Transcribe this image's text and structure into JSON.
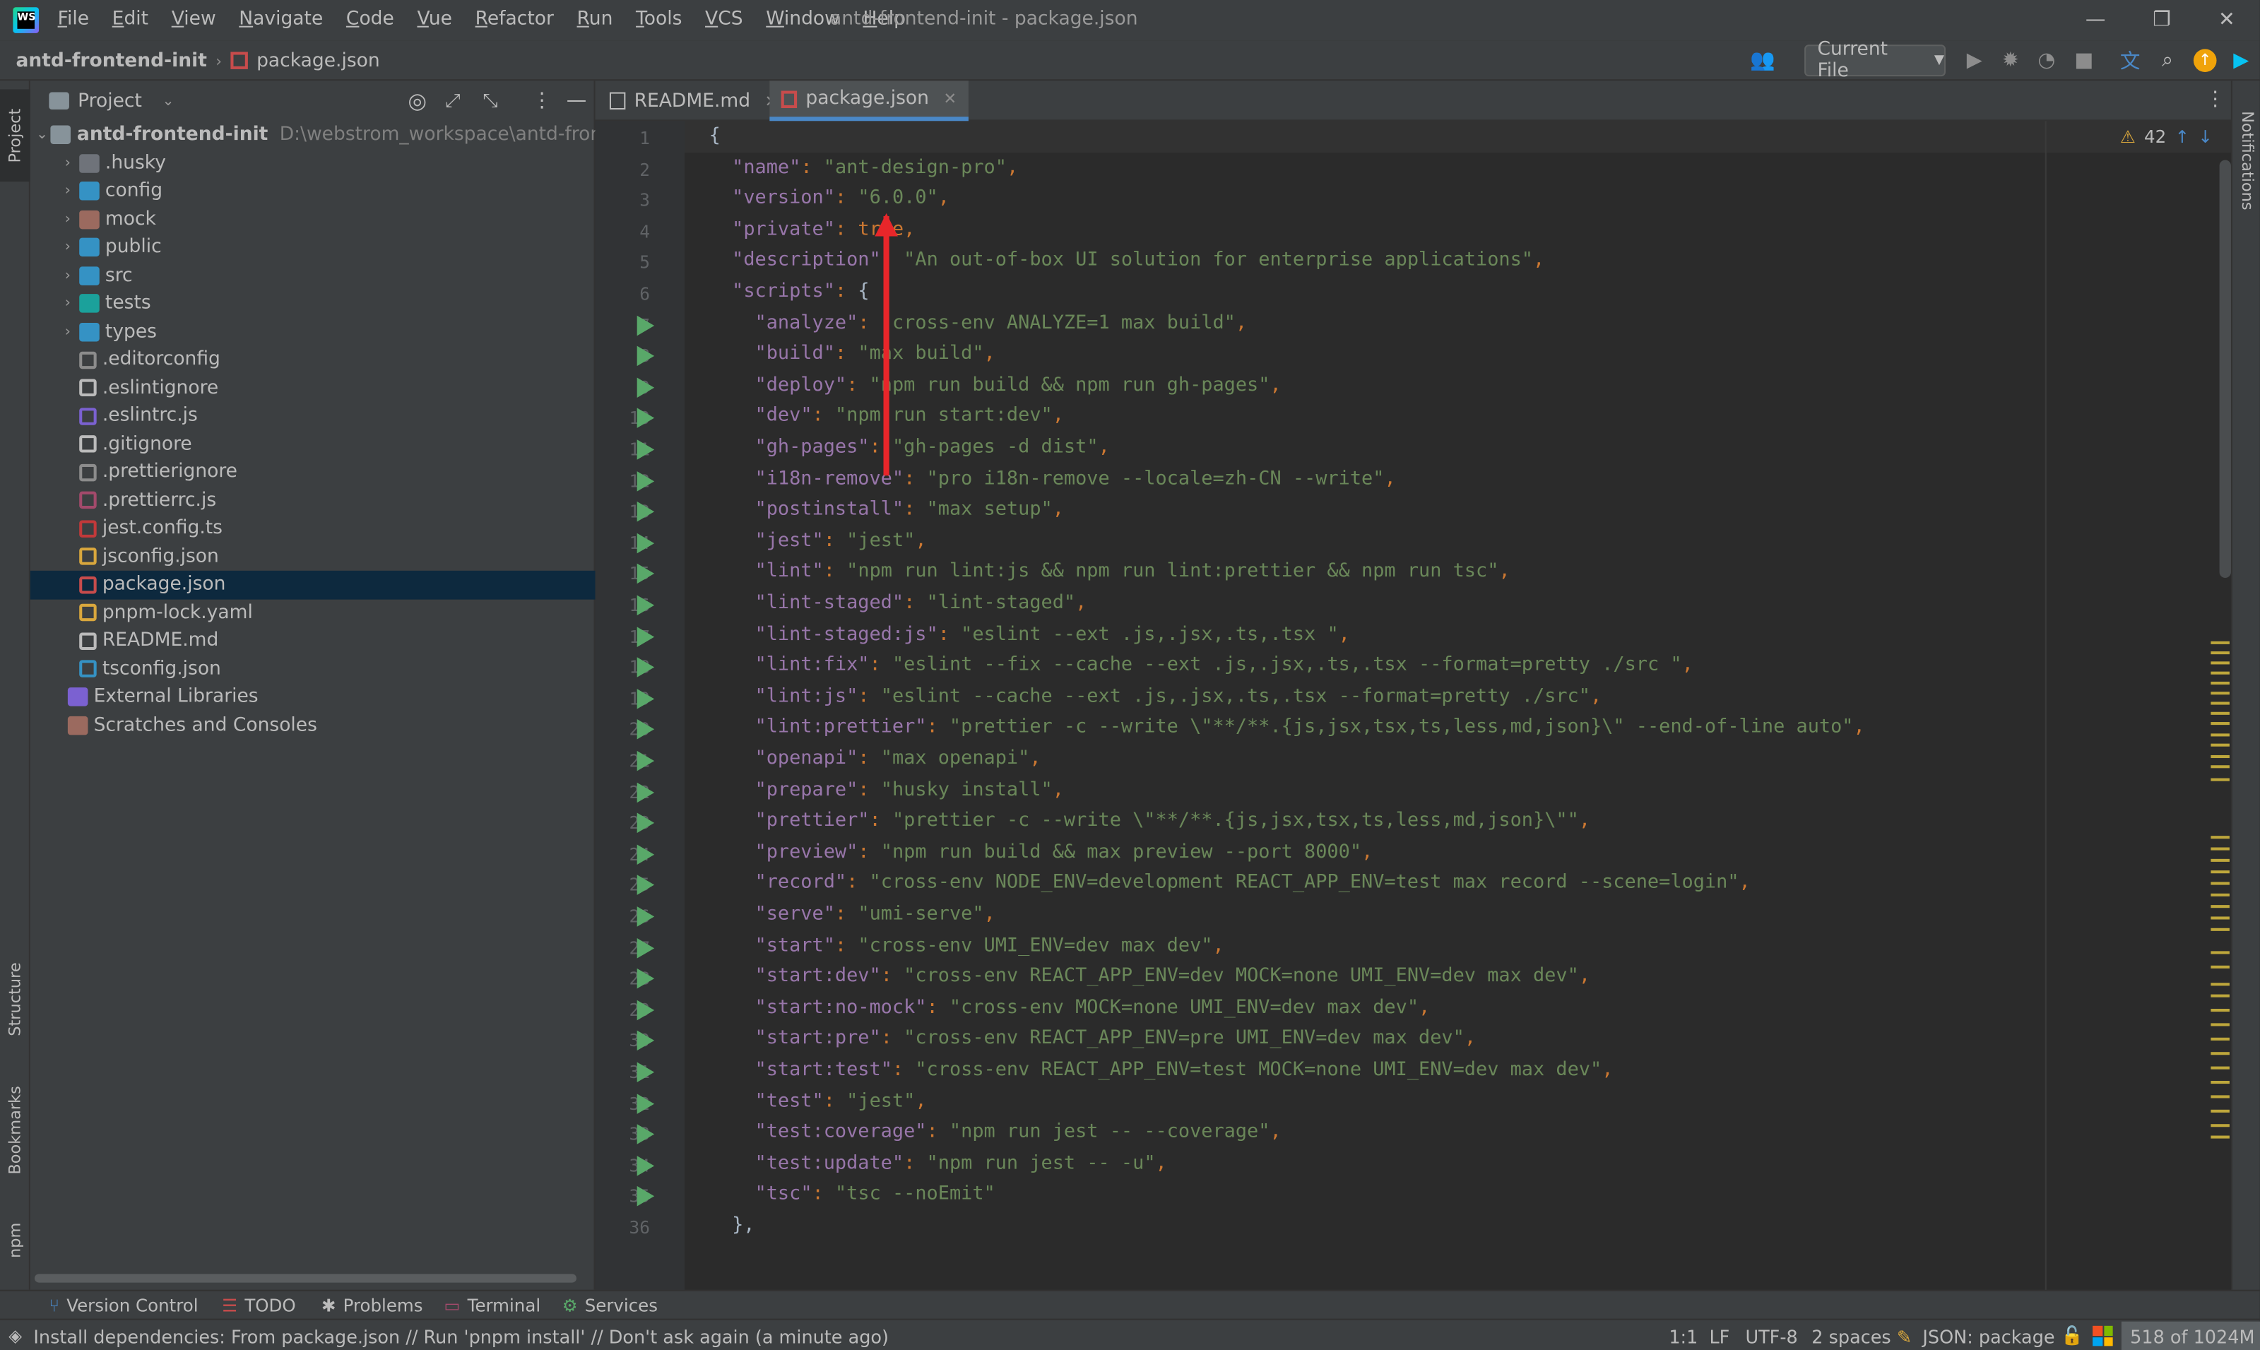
{
  "window": {
    "title": "antd-frontend-init - package.json",
    "menu": [
      "File",
      "Edit",
      "View",
      "Navigate",
      "Code",
      "Vue",
      "Refactor",
      "Run",
      "Tools",
      "VCS",
      "Window",
      "Help"
    ]
  },
  "navbar": {
    "project": "antd-frontend-init",
    "file": "package.json",
    "run_config": "Current File"
  },
  "project_panel": {
    "title": "Project",
    "root_name": "antd-frontend-init",
    "root_path": "D:\\webstrom_workspace\\antd-frontend-init",
    "items": [
      {
        "label": ".husky",
        "folder": true,
        "color": "#6f737a"
      },
      {
        "label": "config",
        "folder": true,
        "color": "#3592c4"
      },
      {
        "label": "mock",
        "folder": true,
        "color": "#9b6a5f"
      },
      {
        "label": "public",
        "folder": true,
        "color": "#3592c4"
      },
      {
        "label": "src",
        "folder": true,
        "color": "#3592c4"
      },
      {
        "label": "tests",
        "folder": true,
        "color": "#1ba19b"
      },
      {
        "label": "types",
        "folder": true,
        "color": "#3592c4"
      },
      {
        "label": ".editorconfig",
        "folder": false,
        "color": "#8c8c8c"
      },
      {
        "label": ".eslintignore",
        "folder": false,
        "color": "#bbbbbb"
      },
      {
        "label": ".eslintrc.js",
        "folder": false,
        "color": "#7b61d1"
      },
      {
        "label": ".gitignore",
        "folder": false,
        "color": "#bbbbbb"
      },
      {
        "label": ".prettierignore",
        "folder": false,
        "color": "#8c8c8c"
      },
      {
        "label": ".prettierrc.js",
        "folder": false,
        "color": "#a34a6b"
      },
      {
        "label": "jest.config.ts",
        "folder": false,
        "color": "#c2393a"
      },
      {
        "label": "jsconfig.json",
        "folder": false,
        "color": "#d9a73d"
      },
      {
        "label": "package.json",
        "folder": false,
        "color": "#c74c4c",
        "selected": true
      },
      {
        "label": "pnpm-lock.yaml",
        "folder": false,
        "color": "#d9a73d"
      },
      {
        "label": "README.md",
        "folder": false,
        "color": "#bbbbbb"
      },
      {
        "label": "tsconfig.json",
        "folder": false,
        "color": "#3592c4"
      }
    ],
    "extra": [
      "External Libraries",
      "Scratches and Consoles"
    ]
  },
  "tabs": [
    {
      "label": "README.md",
      "active": false
    },
    {
      "label": "package.json",
      "active": true
    }
  ],
  "inspection": {
    "warnings": "42"
  },
  "code_lines": [
    {
      "n": "1",
      "run": false,
      "text": "{"
    },
    {
      "n": "2",
      "run": false,
      "key": "name",
      "val": "ant-design-pro",
      "ind": 1
    },
    {
      "n": "3",
      "run": false,
      "key": "version",
      "val": "6.0.0",
      "ind": 1
    },
    {
      "n": "4",
      "run": false,
      "key": "private",
      "raw": "true",
      "ind": 1
    },
    {
      "n": "5",
      "run": false,
      "key": "description",
      "val": "An out-of-box UI solution for enterprise applications",
      "ind": 1
    },
    {
      "n": "6",
      "run": false,
      "key": "scripts",
      "raw": "{",
      "ind": 1,
      "nocomma": true
    },
    {
      "n": "7",
      "run": true,
      "key": "analyze",
      "val": "cross-env ANALYZE=1 max build",
      "ind": 2
    },
    {
      "n": "8",
      "run": true,
      "key": "build",
      "val": "max build",
      "ind": 2
    },
    {
      "n": "9",
      "run": true,
      "key": "deploy",
      "val": "npm run build && npm run gh-pages",
      "ind": 2
    },
    {
      "n": "10",
      "run": true,
      "key": "dev",
      "val": "npm run start:dev",
      "ind": 2
    },
    {
      "n": "11",
      "run": true,
      "key": "gh-pages",
      "val": "gh-pages -d dist",
      "ind": 2
    },
    {
      "n": "12",
      "run": true,
      "key": "i18n-remove",
      "val": "pro i18n-remove --locale=zh-CN --write",
      "ind": 2
    },
    {
      "n": "13",
      "run": true,
      "key": "postinstall",
      "val": "max setup",
      "ind": 2
    },
    {
      "n": "14",
      "run": true,
      "key": "jest",
      "val": "jest",
      "ind": 2
    },
    {
      "n": "15",
      "run": true,
      "key": "lint",
      "val": "npm run lint:js && npm run lint:prettier && npm run tsc",
      "ind": 2
    },
    {
      "n": "16",
      "run": true,
      "key": "lint-staged",
      "val": "lint-staged",
      "ind": 2
    },
    {
      "n": "17",
      "run": true,
      "key": "lint-staged:js",
      "val": "eslint --ext .js,.jsx,.ts,.tsx ",
      "ind": 2
    },
    {
      "n": "18",
      "run": true,
      "key": "lint:fix",
      "val": "eslint --fix --cache --ext .js,.jsx,.ts,.tsx --format=pretty ./src ",
      "ind": 2
    },
    {
      "n": "19",
      "run": true,
      "key": "lint:js",
      "val": "eslint --cache --ext .js,.jsx,.ts,.tsx --format=pretty ./src",
      "ind": 2
    },
    {
      "n": "20",
      "run": true,
      "key": "lint:prettier",
      "val": "prettier -c --write \\\"**/**.{js,jsx,tsx,ts,less,md,json}\\\" --end-of-line auto",
      "ind": 2
    },
    {
      "n": "21",
      "run": true,
      "key": "openapi",
      "val": "max openapi",
      "ind": 2
    },
    {
      "n": "22",
      "run": true,
      "key": "prepare",
      "val": "husky install",
      "ind": 2
    },
    {
      "n": "23",
      "run": true,
      "key": "prettier",
      "val": "prettier -c --write \\\"**/**.{js,jsx,tsx,ts,less,md,json}\\\"",
      "ind": 2
    },
    {
      "n": "24",
      "run": true,
      "key": "preview",
      "val": "npm run build && max preview --port 8000",
      "ind": 2
    },
    {
      "n": "25",
      "run": true,
      "key": "record",
      "val": "cross-env NODE_ENV=development REACT_APP_ENV=test max record --scene=login",
      "ind": 2
    },
    {
      "n": "26",
      "run": true,
      "key": "serve",
      "val": "umi-serve",
      "ind": 2
    },
    {
      "n": "27",
      "run": true,
      "key": "start",
      "val": "cross-env UMI_ENV=dev max dev",
      "ind": 2
    },
    {
      "n": "28",
      "run": true,
      "key": "start:dev",
      "val": "cross-env REACT_APP_ENV=dev MOCK=none UMI_ENV=dev max dev",
      "ind": 2
    },
    {
      "n": "29",
      "run": true,
      "key": "start:no-mock",
      "val": "cross-env MOCK=none UMI_ENV=dev max dev",
      "ind": 2
    },
    {
      "n": "30",
      "run": true,
      "key": "start:pre",
      "val": "cross-env REACT_APP_ENV=pre UMI_ENV=dev max dev",
      "ind": 2
    },
    {
      "n": "31",
      "run": true,
      "key": "start:test",
      "val": "cross-env REACT_APP_ENV=test MOCK=none UMI_ENV=dev max dev",
      "ind": 2
    },
    {
      "n": "32",
      "run": true,
      "key": "test",
      "val": "jest",
      "ind": 2
    },
    {
      "n": "33",
      "run": true,
      "key": "test:coverage",
      "val": "npm run jest -- --coverage",
      "ind": 2
    },
    {
      "n": "34",
      "run": true,
      "key": "test:update",
      "val": "npm run jest -- -u",
      "ind": 2
    },
    {
      "n": "35",
      "run": true,
      "key": "tsc",
      "val": "tsc --noEmit",
      "ind": 2,
      "nocomma": true
    },
    {
      "n": "36",
      "run": false,
      "text": "  },"
    }
  ],
  "left_strip": {
    "project": "Project",
    "structure": "Structure",
    "bookmarks": "Bookmarks",
    "npm": "npm"
  },
  "right_strip": {
    "notifications": "Notifications"
  },
  "bottom_tabs": [
    "Version Control",
    "TODO",
    "Problems",
    "Terminal",
    "Services"
  ],
  "status": {
    "message": "Install dependencies: From package.json // Run 'pnpm install' // Don't ask again (a minute ago)",
    "position": "1:1",
    "line_sep": "LF",
    "encoding": "UTF-8",
    "indent": "2 spaces",
    "schema": "JSON: package",
    "memory": "518 of 1024M"
  },
  "colors": {
    "accent": "#4a88c7",
    "annotation_arrow": "#e8262a",
    "run_icon": "#59a869"
  }
}
